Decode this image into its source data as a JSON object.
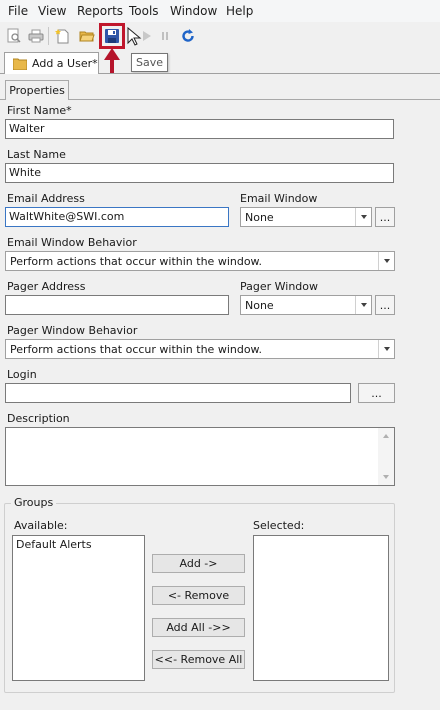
{
  "menu": {
    "items": [
      {
        "label": "File"
      },
      {
        "label": "View"
      },
      {
        "label": "Reports"
      },
      {
        "label": "Tools"
      },
      {
        "label": "Window"
      },
      {
        "label": "Help"
      }
    ]
  },
  "toolbar": {
    "save_tooltip": "Save"
  },
  "document_tab": {
    "label": "Add a User*"
  },
  "properties_tab": {
    "label": "Properties"
  },
  "form": {
    "first_name": {
      "label": "First Name*",
      "value": "Walter"
    },
    "last_name": {
      "label": "Last Name",
      "value": "White"
    },
    "email_address": {
      "label": "Email Address",
      "value": "WaltWhite@SWI.com"
    },
    "email_window": {
      "label": "Email Window",
      "value": "None",
      "browse": "..."
    },
    "email_window_behavior": {
      "label": "Email Window Behavior",
      "value": "Perform actions that occur within the window."
    },
    "pager_address": {
      "label": "Pager Address",
      "value": ""
    },
    "pager_window": {
      "label": "Pager Window",
      "value": "None",
      "browse": "..."
    },
    "pager_window_behavior": {
      "label": "Pager Window Behavior",
      "value": "Perform actions that occur within the window."
    },
    "login": {
      "label": "Login",
      "value": "",
      "browse": "..."
    },
    "description": {
      "label": "Description",
      "value": ""
    }
  },
  "groups": {
    "title": "Groups",
    "available_label": "Available:",
    "selected_label": "Selected:",
    "available_items": [
      "Default Alerts"
    ],
    "selected_items": [],
    "buttons": {
      "add": "Add ->",
      "remove": "<- Remove",
      "add_all": "Add All ->>",
      "remove_all": "<<- Remove All"
    }
  },
  "colors": {
    "highlight": "#c0172c",
    "focus_border": "#3a76c4"
  }
}
